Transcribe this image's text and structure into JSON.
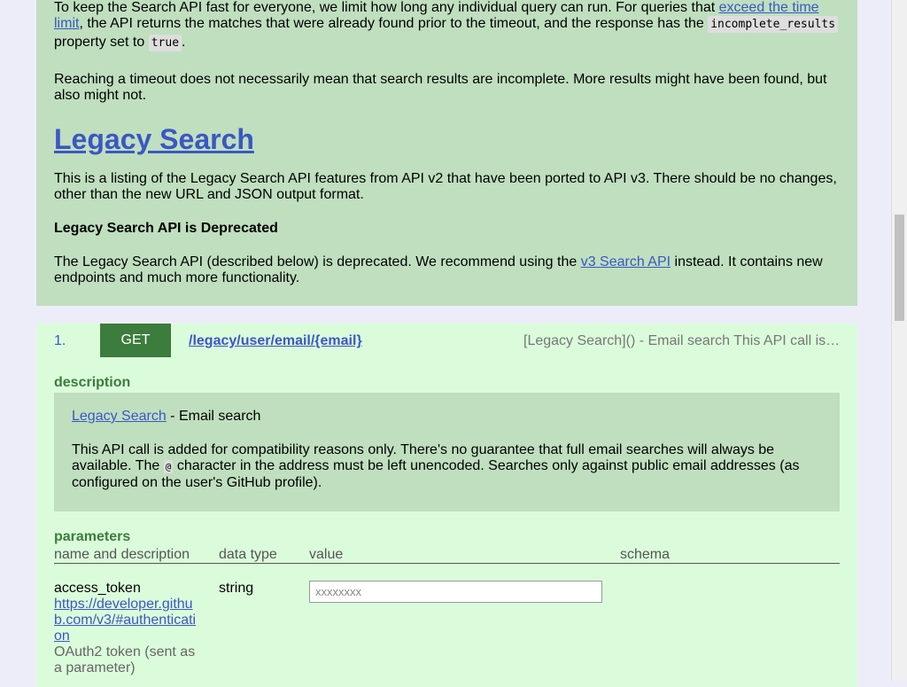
{
  "top": {
    "rate_para": {
      "before_link": "To keep the Search API fast for everyone, we limit how long any individual query can run. For queries that ",
      "link": "exceed the time limit",
      "after_link": ", the API returns the matches that were already found prior to the timeout, and the response has the ",
      "code1": "incomplete_results",
      "mid": "property set to ",
      "code2": "true",
      "end": "."
    },
    "timeout_para": "Reaching a timeout does not necessarily mean that search results are incomplete. More results might have been found, but also might not.",
    "legacy_title": "Legacy Search",
    "legacy_intro": "This is a listing of the Legacy Search API features from API v2 that have been ported to API v3. There should be no changes, other than the new URL and JSON output format.",
    "deprecated_heading": "Legacy Search API is Deprecated",
    "deprecated_para": {
      "before_link": "The Legacy Search API (described below) is deprecated. We recommend using the ",
      "link": "v3 Search API",
      "after_link": " instead. It contains new endpoints and much more functionality."
    }
  },
  "endpoint": {
    "number": "1.",
    "method": "GET",
    "path": "/legacy/user/email/{email}",
    "summary": "[Legacy Search]() - Email search This API call is added for compatibility reasons only.",
    "description_label": "description",
    "description": {
      "link": "Legacy Search",
      "after_link": " - Email search",
      "para_before_code": "This API call is added for compatibility reasons only. There's no guarantee that full email searches will always be available. The ",
      "code": "@",
      "para_after_code": " character in the address must be left unencoded. Searches only against public email addresses (as configured on the user's GitHub profile)."
    },
    "parameters_label": "parameters",
    "param_columns": [
      "name and description",
      "data type",
      "value",
      "schema"
    ],
    "params": [
      {
        "name": "access_token",
        "link": "https://developer.github.com/v3/#authentication",
        "note": "OAuth2 token (sent as a parameter)",
        "type": "string",
        "placeholder": "xxxxxxxx"
      }
    ]
  }
}
